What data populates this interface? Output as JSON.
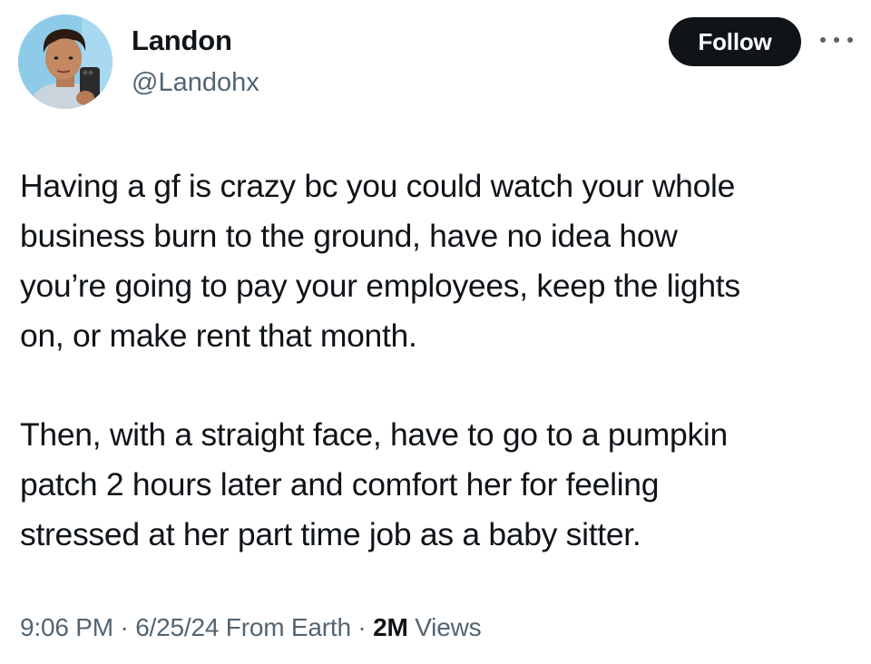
{
  "author": {
    "display_name": "Landon",
    "handle": "@Landohx",
    "avatar": "profile-photo"
  },
  "actions": {
    "follow_label": "Follow",
    "more_icon": "more-horizontal-icon"
  },
  "tweet": {
    "paragraph_1": "Having a gf is crazy bc you could watch your whole\nbusiness burn to the ground, have no idea how\nyou’re going to pay your employees, keep the lights\non, or make rent that month.",
    "paragraph_2": "Then, with a straight face, have to go to a pumpkin\npatch 2 hours later and comfort her for feeling\nstressed at her part time job as a baby sitter."
  },
  "meta": {
    "time": "9:06 PM",
    "separator_1": " · ",
    "date": "6/25/24",
    "source": " From Earth",
    "separator_2": " · ",
    "views_count": "2M",
    "views_label": " Views"
  },
  "colors": {
    "text_primary": "#0f1419",
    "text_secondary": "#536471",
    "button_bg": "#0f1419",
    "button_text": "#ffffff"
  }
}
